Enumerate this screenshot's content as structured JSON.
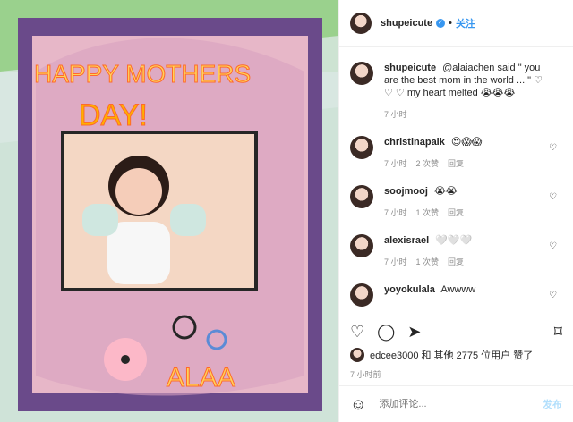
{
  "header": {
    "username": "shupeicute",
    "follow": "关注"
  },
  "media": {
    "card_title_line1": "HAPPY MOTHERS",
    "card_title_line2": "DAY!",
    "name_on_card": "ALAA"
  },
  "caption": {
    "username": "shupeicute",
    "text": "@alaiachen said \" you are the best mom in the world ... \" ♡ ♡ ♡ my heart melted 😭😭😭",
    "time": "7 小时"
  },
  "comments": [
    {
      "username": "christinapaik",
      "text": "😍😱😱",
      "time": "7 小时",
      "likes": "2 次赞",
      "reply": "回复"
    },
    {
      "username": "soojmooj",
      "text": "😭😭",
      "time": "7 小时",
      "likes": "1 次赞",
      "reply": "回复"
    },
    {
      "username": "alexisrael",
      "text": "🤍🤍🤍",
      "time": "7 小时",
      "likes": "1 次赞",
      "reply": "回复"
    },
    {
      "username": "yoyokulala",
      "text": "Awwww",
      "time": "",
      "likes": "",
      "reply": ""
    }
  ],
  "likes": {
    "text": "edcee3000 和 其他 2775 位用户 赞了"
  },
  "post_time": "7 小时前",
  "composer": {
    "placeholder": "添加评论...",
    "post_label": "发布"
  }
}
